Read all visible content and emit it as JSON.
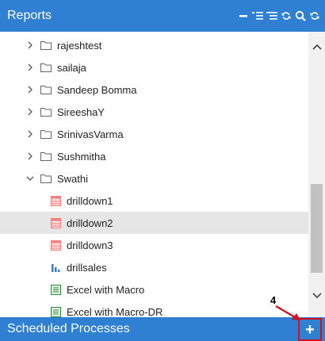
{
  "header": {
    "title": "Reports"
  },
  "tree": {
    "folders": [
      {
        "label": "rajeshtest",
        "expanded": false
      },
      {
        "label": "sailaja",
        "expanded": false
      },
      {
        "label": "Sandeep Bomma",
        "expanded": false
      },
      {
        "label": "SireeshaY",
        "expanded": false
      },
      {
        "label": "SrinivasVarma",
        "expanded": false
      },
      {
        "label": "Sushmitha",
        "expanded": false
      },
      {
        "label": "Swathi",
        "expanded": true
      }
    ],
    "children": [
      {
        "label": "drilldown1",
        "icon": "table-report-icon",
        "selected": false
      },
      {
        "label": "drilldown2",
        "icon": "table-report-icon",
        "selected": true
      },
      {
        "label": "drilldown3",
        "icon": "table-report-icon",
        "selected": false
      },
      {
        "label": "drillsales",
        "icon": "bar-chart-icon",
        "selected": false
      },
      {
        "label": "Excel with Macro",
        "icon": "excel-icon",
        "selected": false
      },
      {
        "label": "Excel with Macro-DR",
        "icon": "excel-icon",
        "selected": false
      }
    ]
  },
  "footer": {
    "title": "Scheduled Processes",
    "add_label": "+"
  },
  "callout": {
    "number": "4"
  },
  "colors": {
    "header_bg": "#2f7fd2",
    "callout": "#d0101e",
    "report_icon": "#f08080",
    "chart_icon": "#2f7fd2",
    "excel_icon": "#2e8b3d"
  }
}
